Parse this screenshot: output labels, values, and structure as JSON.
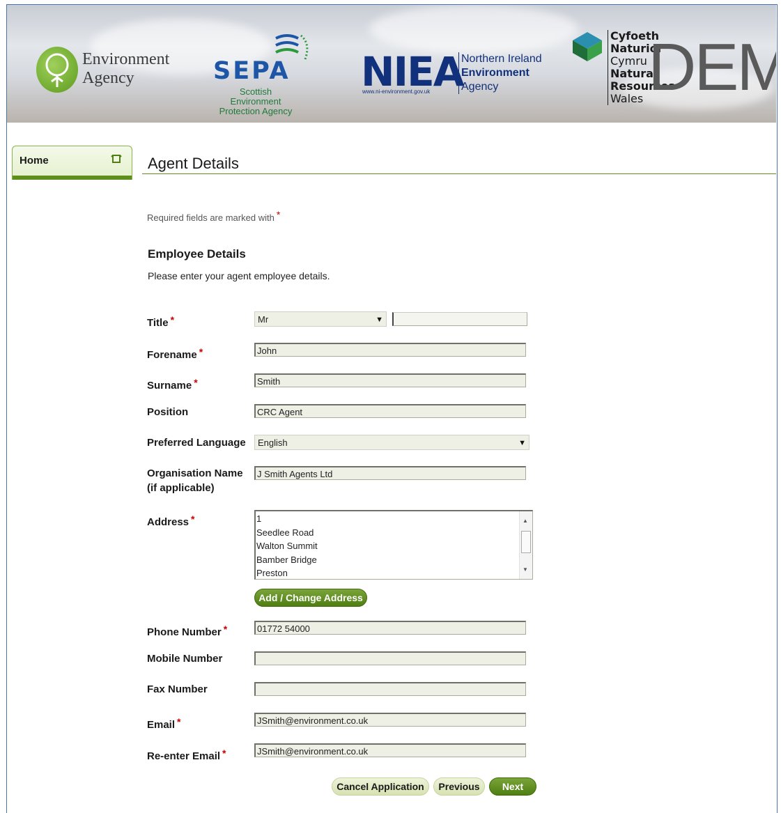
{
  "header": {
    "ea_name_line1": "Environment",
    "ea_name_line2": "Agency",
    "sepa_abbr": "SEPA",
    "sepa_full_line1": "Scottish Environment",
    "sepa_full_line2": "Protection Agency",
    "niea_abbr": "NIEA",
    "niea_web": "www.ni-environment.gov.uk",
    "niea_line1": "Northern Ireland",
    "niea_line2": "Environment",
    "niea_line3": "Agency",
    "nrw_line1": "Cyfoeth",
    "nrw_line2": "Naturiol",
    "nrw_line3": "Cymru",
    "nrw_line4": "Natural",
    "nrw_line5": "Resources",
    "nrw_line6": "Wales",
    "watermark": "DEMO"
  },
  "sidebar": {
    "home_label": "Home"
  },
  "main": {
    "title": "Agent Details",
    "required_note": "Required fields are marked with",
    "required_marker": "*",
    "section_title": "Employee Details",
    "section_desc": "Please enter your agent employee details."
  },
  "form": {
    "title_label": "Title",
    "title_value": "Mr",
    "title_other": "",
    "forename_label": "Forename",
    "forename_value": "John",
    "surname_label": "Surname",
    "surname_value": "Smith",
    "position_label": "Position",
    "position_value": "CRC Agent",
    "language_label": "Preferred Language",
    "language_value": "English",
    "org_label": "Organisation Name (if applicable)",
    "org_value": "J Smith Agents Ltd",
    "address_label": "Address",
    "address_lines": [
      "1",
      "Seedlee Road",
      "Walton Summit",
      "Bamber Bridge",
      "Preston"
    ],
    "address_button": "Add / Change Address",
    "phone_label": "Phone Number",
    "phone_value": "01772 54000",
    "mobile_label": "Mobile Number",
    "mobile_value": "",
    "fax_label": "Fax Number",
    "fax_value": "",
    "email_label": "Email",
    "email_value": "JSmith@environment.co.uk",
    "reemail_label": "Re-enter Email",
    "reemail_value": "JSmith@environment.co.uk"
  },
  "actions": {
    "cancel": "Cancel Application",
    "previous": "Previous",
    "next": "Next"
  },
  "colors": {
    "accent_green": "#5e8f1c",
    "required_red": "#cc0000",
    "frame_blue": "#4a73a8"
  }
}
